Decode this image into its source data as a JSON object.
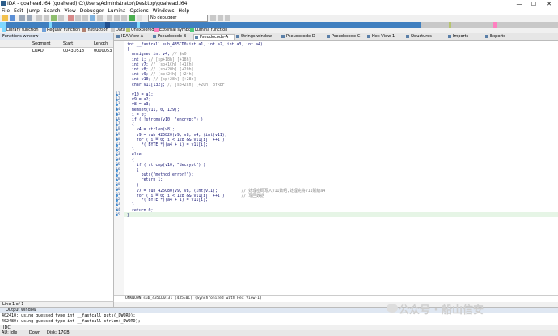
{
  "window": {
    "title": "IDA - goahead.i64 (goahead) C:\\Users\\Administrator\\Desktop\\goahead.i64",
    "minimize": "—",
    "maximize": "☐",
    "close": "✕"
  },
  "menu": [
    "File",
    "Edit",
    "Jump",
    "Search",
    "View",
    "Debugger",
    "Lumina",
    "Options",
    "Windows",
    "Help"
  ],
  "toolbar": {
    "debugger_select": "No debugger"
  },
  "legend": [
    {
      "label": "Library function",
      "color": "#7fd8ff"
    },
    {
      "label": "Regular function",
      "color": "#6fa0d8"
    },
    {
      "label": "Instruction",
      "color": "#b08070"
    },
    {
      "label": "Data",
      "color": "#c8c8c8"
    },
    {
      "label": "Unexplored",
      "color": "#b6c46e"
    },
    {
      "label": "External symbol",
      "color": "#ff80c0"
    },
    {
      "label": "Lumina function",
      "color": "#50c878"
    }
  ],
  "functions_window": {
    "title": "Functions window",
    "columns": [
      "Segment",
      "Start",
      "Length"
    ],
    "rows": [
      {
        "name": "",
        "segment": "LOAD",
        "start": "0043D518",
        "length": "0000053"
      }
    ]
  },
  "line_indicator": "Line 1 of 1",
  "tabs": [
    "IDA View-A",
    "Pseudocode-B",
    "Pseudocode-A",
    "Strings window",
    "Pseudocode-D",
    "Pseudocode-C",
    "Hex View-1",
    "Structures",
    "Imports",
    "Exports"
  ],
  "active_tab": "Pseudocode-A",
  "code": {
    "lines": [
      {
        "n": "",
        "text": "int __fastcall sub_435CD0(int a1, int a2, int a3, int a4)"
      },
      {
        "n": "",
        "text": "{"
      },
      {
        "n": "",
        "text": "  unsigned int v4; // $v0"
      },
      {
        "n": "",
        "text": "  int i; // [sp+18h] [+18h]"
      },
      {
        "n": "",
        "text": "  int v7; // [sp+1Ch] [+1Ch]"
      },
      {
        "n": "",
        "text": "  int v8; // [sp+20h] [+20h]"
      },
      {
        "n": "",
        "text": "  int v9; // [sp+24h] [+24h]"
      },
      {
        "n": "",
        "text": "  int v10; // [sp+28h] [+28h]"
      },
      {
        "n": "",
        "text": "  char v11[132]; // [sp+2Ch] [+2Ch] BYREF"
      },
      {
        "n": "",
        "text": ""
      },
      {
        "n": "11",
        "text": "  v10 = a1;"
      },
      {
        "n": "12",
        "text": "  v9 = a2;"
      },
      {
        "n": "13",
        "text": "  v8 = a3;"
      },
      {
        "n": "14",
        "text": "  memset(v11, 0, 129);"
      },
      {
        "n": "15",
        "text": "  i = 0;"
      },
      {
        "n": "16",
        "text": "  if ( !strcmp(v10, \"encrypt\") )"
      },
      {
        "n": "17",
        "text": "  {"
      },
      {
        "n": "18",
        "text": "    v4 = strlen(v8);"
      },
      {
        "n": "19",
        "text": "    v9 = sub_425820(v9, v8, v4, (int)v11);"
      },
      {
        "n": "20",
        "text": "    for ( i = 0; i < 128 && v11[i]; ++i )"
      },
      {
        "n": "21",
        "text": "      *(_BYTE *)(a4 + i) = v11[i];"
      },
      {
        "n": "22",
        "text": "  }"
      },
      {
        "n": "23",
        "text": "  else"
      },
      {
        "n": "24",
        "text": "  {"
      },
      {
        "n": "25",
        "text": "    if ( strcmp(v10, \"decrypt\") )"
      },
      {
        "n": "26",
        "text": "    {"
      },
      {
        "n": "27",
        "text": "      puts(\"method error!\");"
      },
      {
        "n": "28",
        "text": "      return 1;"
      },
      {
        "n": "29",
        "text": "    }"
      },
      {
        "n": "30",
        "text": "    v7 = sub_425C80(v9, v8, (int)v11);          // 处理密码写入v11数组,处理完将v11赋给a4"
      },
      {
        "n": "31",
        "text": "    for ( i = 0; i < 128 && v11[i]; ++i )       // 写回数据"
      },
      {
        "n": "32",
        "text": "      *(_BYTE *)(a4 + i) = v11[i];"
      },
      {
        "n": "33",
        "text": "  }"
      },
      {
        "n": "34",
        "text": "  return 0;"
      },
      {
        "n": "35",
        "text": "}"
      }
    ],
    "status": "UNKNOWN sub_435CD0:31 (435E0C) (Synchronized with Hex View-1)"
  },
  "output": {
    "title": "Output window",
    "lines": [
      "402410: using guessed type int __fastcall puts(_DWORD);",
      "402480: using guessed type int __fastcall strlen(_DWORD);"
    ],
    "input_label": "IDC"
  },
  "statusbar": {
    "state": "AU: idle",
    "dir": "Down",
    "disk": "Disk: 17GB"
  },
  "watermark": "公众号 · 船山信安"
}
